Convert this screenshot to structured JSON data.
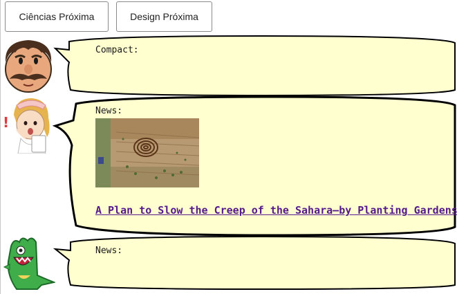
{
  "toolbar": {
    "button1_label": "Ciências Próxima",
    "button2_label": "Design Próxima"
  },
  "messages": [
    {
      "avatar": "mustache-man-icon",
      "label": "Compact:"
    },
    {
      "avatar": "nurse-icon",
      "label": "News:",
      "link_text": "A Plan to Slow the Creep of the Sahara—by Planting Gardens",
      "image": "aerial-garden-photo"
    },
    {
      "avatar": "green-monster-icon",
      "label": "News:"
    }
  ],
  "colors": {
    "bubble_fill": "#ffffd0",
    "bubble_border": "#000000",
    "link": "#551a8b"
  }
}
